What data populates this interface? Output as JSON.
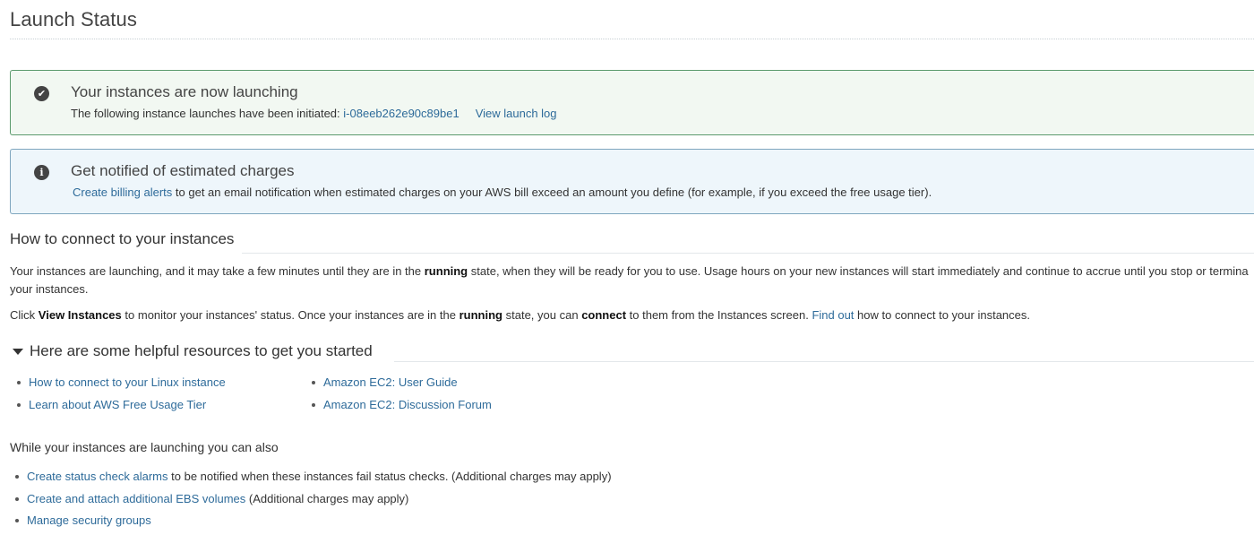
{
  "page": {
    "title": "Launch Status"
  },
  "success_alert": {
    "icon": "check-circle-icon",
    "title": "Your instances are now launching",
    "body_text": "The following instance launches have been initiated:",
    "instance_id": "i-08eeb262e90c89be1",
    "launch_log_link": "View launch log"
  },
  "info_alert": {
    "icon": "info-circle-icon",
    "title": "Get notified of estimated charges",
    "billing_link": "Create billing alerts",
    "body_text": "to get an email notification when estimated charges on your AWS bill exceed an amount you define (for example, if you exceed the free usage tier)."
  },
  "connect_section": {
    "title": "How to connect to your instances",
    "para1_a": "Your instances are launching, and it may take a few minutes until they are in the",
    "para1_bold": "running",
    "para1_b": "state, when they will be ready for you to use. Usage hours on your new instances will start immediately and continue to accrue until you stop or termina",
    "para1_line2": "your instances.",
    "para2_a": "Click",
    "para2_bold_view": "View Instances",
    "para2_b": "to monitor your instances' status. Once your instances are in the",
    "para2_bold_running": "running",
    "para2_c": "state, you can",
    "para2_bold_connect": "connect",
    "para2_d": "to them from the Instances screen.",
    "para2_link": "Find out",
    "para2_e": "how to connect to your instances."
  },
  "resources_section": {
    "title": "Here are some helpful resources to get you started",
    "left_links": [
      "How to connect to your Linux instance",
      "Learn about AWS Free Usage Tier"
    ],
    "right_links": [
      "Amazon EC2: User Guide",
      "Amazon EC2: Discussion Forum"
    ]
  },
  "also_section": {
    "heading": "While your instances are launching you can also",
    "items": [
      {
        "link": "Create status check alarms",
        "text": "to be notified when these instances fail status checks. (Additional charges may apply)"
      },
      {
        "link": "Create and attach additional EBS volumes",
        "text": "(Additional charges may apply)"
      },
      {
        "link": "Manage security groups",
        "text": ""
      }
    ]
  },
  "colors": {
    "link": "#2e6b9a",
    "success_bg": "#f2f8f2",
    "success_border": "#5b9a6d",
    "info_bg": "#eef6fb",
    "info_border": "#7fa6bf"
  }
}
